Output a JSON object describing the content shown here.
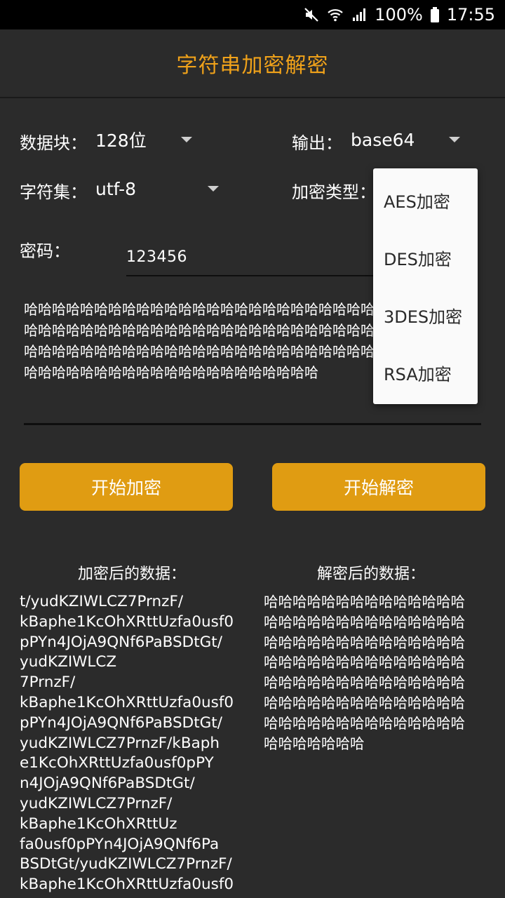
{
  "status_bar": {
    "battery": "100%",
    "time": "17:55"
  },
  "app_bar": {
    "title": "字符串加密解密"
  },
  "settings": {
    "block_label": "数据块：",
    "block_value": "128位",
    "output_label": "输出：",
    "output_value": "base64",
    "charset_label": "字符集：",
    "charset_value": "utf-8",
    "type_label": "加密类型："
  },
  "password": {
    "label": "密码：",
    "value": "123456"
  },
  "plaintext": {
    "value": "哈哈哈哈哈哈哈哈哈哈哈哈哈哈哈哈哈哈哈哈哈哈哈哈哈哈哈哈哈哈哈哈哈哈哈哈哈哈哈哈哈哈哈哈哈哈哈哈哈哈哈哈哈哈哈哈哈哈哈哈哈哈哈哈哈哈哈哈哈哈哈哈哈哈哈哈哈哈哈哈哈哈哈哈哈哈哈哈哈哈哈哈哈哈哈哈"
  },
  "buttons": {
    "encrypt": "开始加密",
    "decrypt": "开始解密"
  },
  "results": {
    "encrypted_title": "加密后的数据：",
    "decrypted_title": "解密后的数据：",
    "encrypted_value": "t/yudKZIWLCZ7PrnzF/\nkBaphe1KcOhXRttUzfa0usf0\npPYn4JOjA9QNf6PaBSDtGt/\nyudKZIWLCZ\n7PrnzF/\nkBaphe1KcOhXRttUzfa0usf0\npPYn4JOjA9QNf6PaBSDtGt/\nyudKZIWLCZ7PrnzF/kBaph\ne1KcOhXRttUzfa0usf0pPY\nn4JOjA9QNf6PaBSDtGt/\nyudKZIWLCZ7PrnzF/\nkBaphe1KcOhXRttUz\nfa0usf0pPYn4JOjA9QNf6Pa\nBSDtGt/yudKZIWLCZ7PrnzF/\nkBaphe1KcOhXRttUzfa0usf0",
    "decrypted_value": "哈哈哈哈哈哈哈哈哈哈哈哈哈哈哈哈哈哈哈哈哈哈哈哈哈哈哈哈哈哈哈哈哈哈哈哈哈哈哈哈哈哈哈哈哈哈哈哈哈哈哈哈哈哈哈哈哈哈哈哈哈哈哈哈哈哈哈哈哈哈哈哈哈哈哈哈哈哈哈哈哈哈哈哈哈哈哈哈哈哈哈哈哈哈哈哈哈哈哈哈哈哈哈哈哈"
  },
  "dropdown": {
    "items": [
      "AES加密",
      "DES加密",
      "3DES加密",
      "RSA加密"
    ]
  },
  "colors": {
    "accent": "#e09c12",
    "title": "#f0a21a",
    "background": "#2b2b2b"
  }
}
